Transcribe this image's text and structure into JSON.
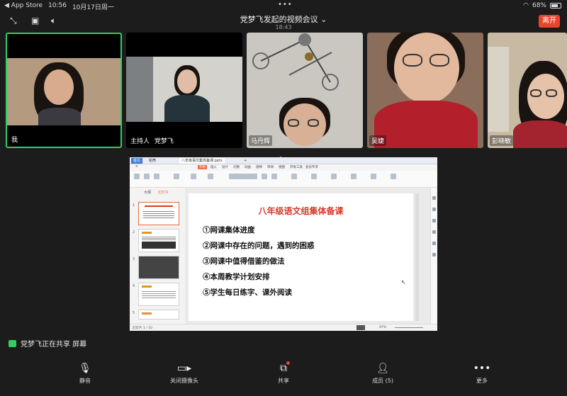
{
  "status_bar": {
    "back_app": "◀ App Store",
    "time": "10:56",
    "date": "10月17日周一",
    "wifi_icon": "wifi-icon",
    "battery": "68%",
    "battery_level": 0.68
  },
  "meeting": {
    "title": "党梦飞发起的视频会议",
    "elapsed": "18:43",
    "leave_label": "离开"
  },
  "participants": [
    {
      "name": "我",
      "role": "",
      "active": true
    },
    {
      "name": "党梦飞",
      "role": "主持人",
      "active": false
    },
    {
      "name": "马丹辉",
      "role": "",
      "active": false
    },
    {
      "name": "吴婕",
      "role": "",
      "active": false
    },
    {
      "name": "彭晓敏",
      "role": "",
      "active": false
    }
  ],
  "shared_screen": {
    "tabs": [
      "首页",
      "稻壳",
      "八年级语文集体备课.pptx",
      "+"
    ],
    "menus": [
      "开始",
      "插入",
      "设计",
      "切换",
      "动画",
      "放映",
      "审阅",
      "视图",
      "开发工具",
      "会员专享"
    ],
    "active_menu": "开始",
    "side_tabs": [
      "大纲",
      "幻灯片"
    ],
    "slide_numbers": [
      "1",
      "2",
      "3",
      "4",
      "5"
    ],
    "slide": {
      "title": "八年级语文组集体备课",
      "items": [
        "①网课集体进度",
        "②网课中存在的问题，遇到的困惑",
        "③网课中值得借鉴的做法",
        "④本周教学计划安排",
        "⑤学生每日练字、课外阅读"
      ]
    },
    "status": {
      "page": "幻灯片 1 / 10",
      "zoom": "97%"
    }
  },
  "share_notice": "党梦飞正在共享 屏幕",
  "toolbar": {
    "mute": "静音",
    "camera_off": "关闭摄像头",
    "share": "共享",
    "members": "成员 (5)",
    "more": "更多"
  }
}
